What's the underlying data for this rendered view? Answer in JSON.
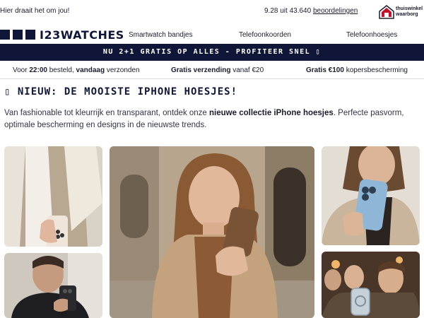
{
  "topbar": {
    "tagline": "Hier draait het om jou!",
    "rating_text": "9.28 uit 43.640 ",
    "rating_link": "beoordelingen",
    "badge_line1": "thuiswinkel",
    "badge_line2": "waarborg"
  },
  "brand": {
    "name": "I23WATCHES"
  },
  "nav": {
    "items": [
      "Smartwatch bandjes",
      "Telefoonkoorden",
      "Telefoonhoesjes"
    ]
  },
  "promo": {
    "text": "NU 2+1 GRATIS OP ALLES - PROFITEER SNEL ▯"
  },
  "usp": {
    "item1_prefix": "Voor ",
    "item1_time": "22:00",
    "item1_mid": " besteld, ",
    "item1_bold": "vandaag",
    "item1_suffix": " verzonden",
    "item2_bold": "Gratis verzending",
    "item2_suffix": " vanaf €20",
    "item3_bold": "Gratis €100",
    "item3_suffix": " kopersbescherming"
  },
  "content": {
    "heading": "▯ NIEUW: DE MOOISTE IPHONE HOESJES!",
    "intro_start": "Van fashionable tot kleurrijk en transparant, ontdek onze ",
    "intro_bold": "nieuwe collectie iPhone hoesjes",
    "intro_end": ". Perfecte pasvorm, optimale bescherming en designs in de nieuwste trends."
  },
  "colors": {
    "navy": "#0f1638",
    "house_red": "#c8102e"
  }
}
